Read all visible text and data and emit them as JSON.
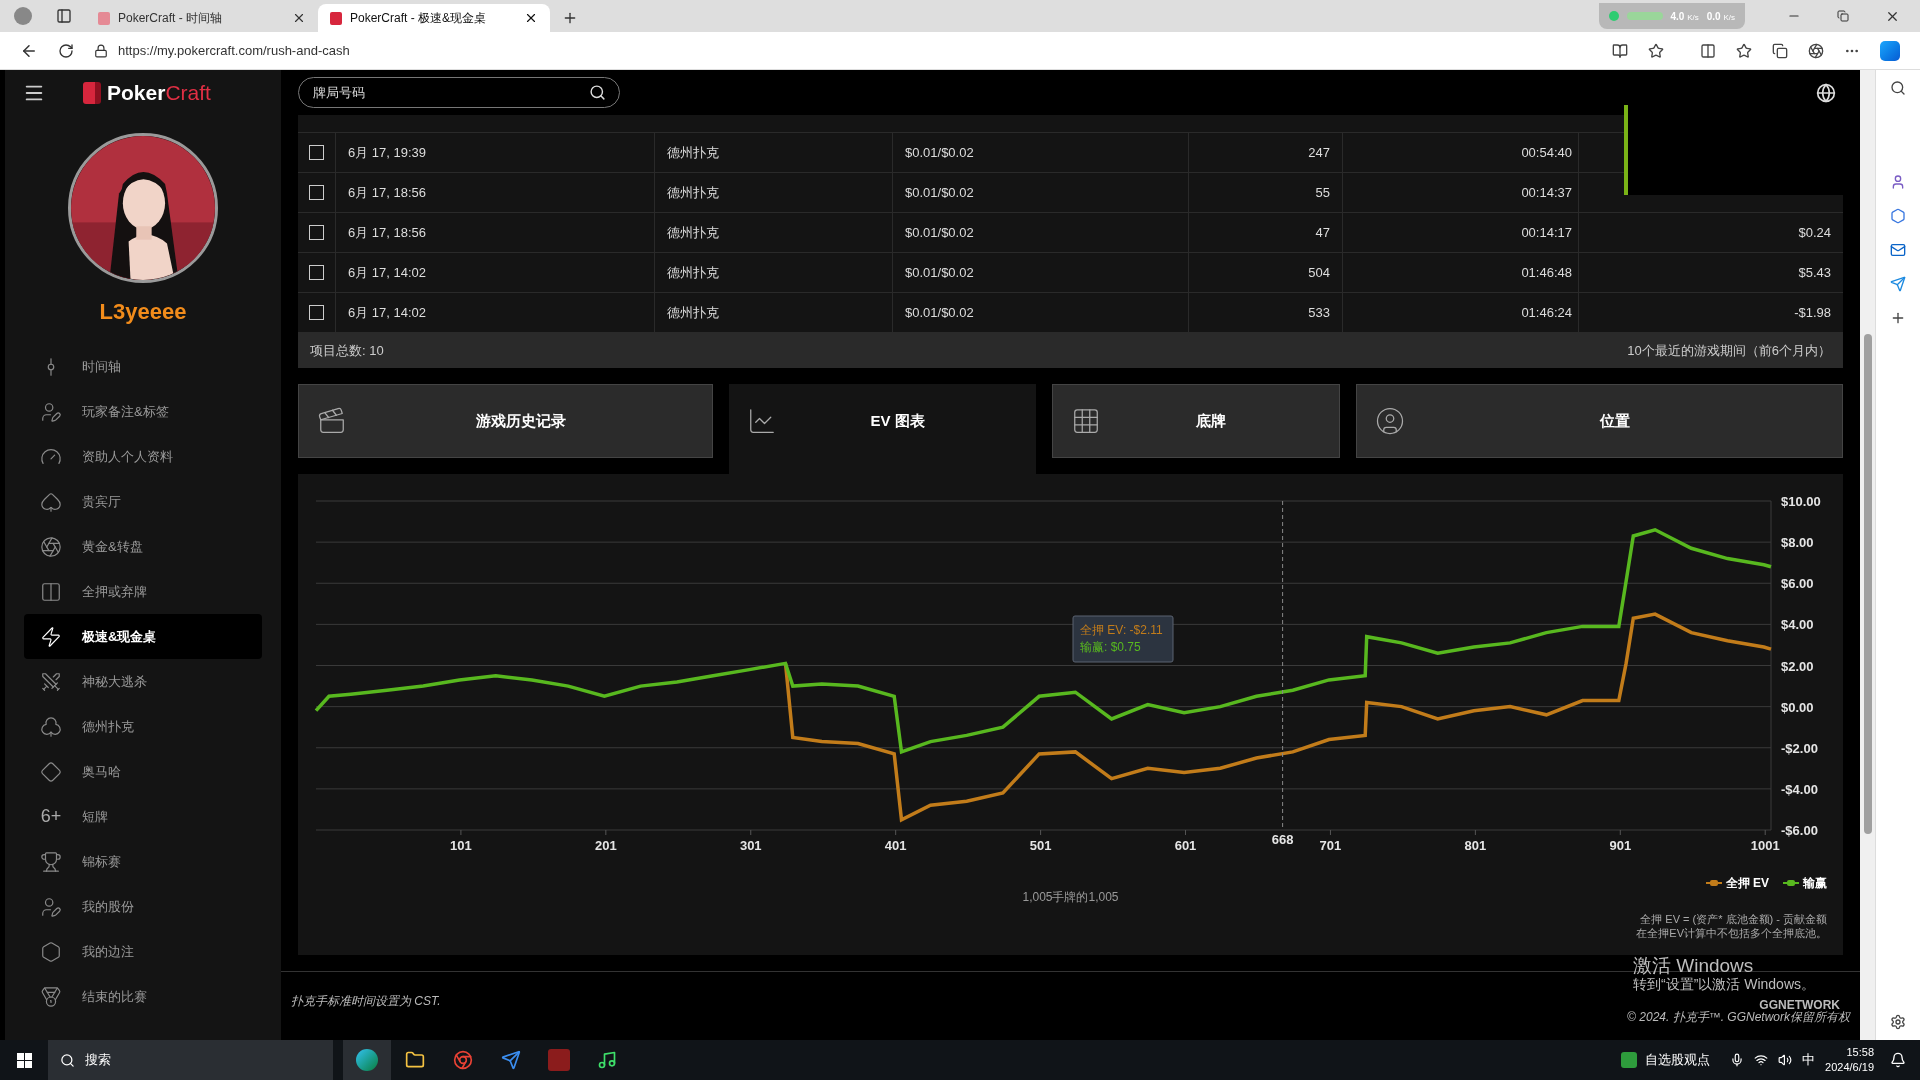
{
  "browser": {
    "tabs": [
      {
        "title": "PokerCraft - 时间轴",
        "selected": false
      },
      {
        "title": "PokerCraft - 极速&现金桌",
        "selected": true
      }
    ],
    "url": "https://my.pokercraft.com/rush-and-cash",
    "network_speeds": [
      {
        "value": "4.0",
        "unit": "K/s"
      },
      {
        "value": "0.0",
        "unit": "K/s"
      }
    ]
  },
  "logo": {
    "first": "Poker",
    "second": "Craft"
  },
  "search": {
    "placeholder": "牌局号码"
  },
  "user": {
    "name": "L3yeeee"
  },
  "nav": [
    {
      "label": "时间轴",
      "selected": false
    },
    {
      "label": "玩家备注&标签",
      "selected": false
    },
    {
      "label": "资助人个人资料",
      "selected": false
    },
    {
      "label": "贵宾厅",
      "selected": false
    },
    {
      "label": "黄金&转盘",
      "selected": false
    },
    {
      "label": "全押或弃牌",
      "selected": false
    },
    {
      "label": "极速&现金桌",
      "selected": true
    },
    {
      "label": "神秘大逃杀",
      "selected": false
    },
    {
      "label": "德州扑克",
      "selected": false
    },
    {
      "label": "奥马哈",
      "selected": false
    },
    {
      "label": "短牌",
      "selected": false,
      "glyph": "6+"
    },
    {
      "label": "锦标赛",
      "selected": false
    },
    {
      "label": "我的股份",
      "selected": false
    },
    {
      "label": "我的边注",
      "selected": false
    },
    {
      "label": "结束的比赛",
      "selected": false
    }
  ],
  "table": {
    "rows": [
      {
        "checked": false,
        "date": "6月 17, 19:39",
        "game": "德州扑克",
        "stakes": "$0.01/$0.02",
        "hands": "247",
        "duration": "00:54:40"
      },
      {
        "checked": false,
        "date": "6月 17, 18:56",
        "game": "德州扑克",
        "stakes": "$0.01/$0.02",
        "hands": "55",
        "duration": "00:14:37"
      },
      {
        "checked": false,
        "date": "6月 17, 18:56",
        "game": "德州扑克",
        "stakes": "$0.01/$0.02",
        "hands": "47",
        "duration": "00:14:17",
        "result": "$0.24"
      },
      {
        "checked": false,
        "date": "6月 17, 14:02",
        "game": "德州扑克",
        "stakes": "$0.01/$0.02",
        "hands": "504",
        "duration": "01:46:48",
        "result": "$5.43"
      },
      {
        "checked": false,
        "date": "6月 17, 14:02",
        "game": "德州扑克",
        "stakes": "$0.01/$0.02",
        "hands": "533",
        "duration": "01:46:24",
        "result": "-$1.98"
      }
    ],
    "total": "项目总数: 10",
    "summary": "10个最近的游戏期间（前6个月内）"
  },
  "view_tabs": [
    {
      "label": "游戏历史记录",
      "selected": false
    },
    {
      "label": "EV 图表",
      "selected": true
    },
    {
      "label": "底牌",
      "selected": false
    },
    {
      "label": "位置",
      "selected": false
    }
  ],
  "ev_chart": {
    "chart_data": {
      "type": "line",
      "x": [
        1,
        10,
        25,
        50,
        75,
        100,
        125,
        150,
        175,
        200,
        225,
        250,
        275,
        300,
        325,
        330,
        350,
        375,
        400,
        405,
        425,
        450,
        475,
        500,
        525,
        550,
        575,
        600,
        625,
        650,
        675,
        700,
        725,
        726,
        750,
        775,
        800,
        825,
        850,
        875,
        900,
        905,
        910,
        925,
        950,
        975,
        1000,
        1005
      ],
      "series": [
        {
          "name": "全押 EV",
          "color": "#c27c1a",
          "values": [
            null,
            null,
            null,
            null,
            null,
            null,
            null,
            null,
            null,
            null,
            null,
            null,
            null,
            null,
            2.1,
            -1.5,
            -1.7,
            -1.8,
            -2.3,
            -5.5,
            -4.8,
            -4.6,
            -4.2,
            -2.3,
            -2.2,
            -3.5,
            -3.0,
            -3.2,
            -3.0,
            -2.5,
            -2.2,
            -1.6,
            -1.4,
            0.2,
            0.0,
            -0.6,
            -0.2,
            0.0,
            -0.4,
            0.3,
            0.3,
            2.1,
            4.3,
            4.5,
            3.6,
            3.2,
            2.9,
            2.8
          ]
        },
        {
          "name": "输赢",
          "color": "#58b81f",
          "values": [
            -0.2,
            0.5,
            0.6,
            0.8,
            1.0,
            1.3,
            1.5,
            1.3,
            1.0,
            0.5,
            1.0,
            1.2,
            1.5,
            1.8,
            2.1,
            1.0,
            1.1,
            1.0,
            0.5,
            -2.2,
            -1.7,
            -1.4,
            -1.0,
            0.5,
            0.7,
            -0.6,
            0.1,
            -0.3,
            0.0,
            0.5,
            0.8,
            1.3,
            1.5,
            3.4,
            3.1,
            2.6,
            2.9,
            3.1,
            3.6,
            3.9,
            3.9,
            6.1,
            8.3,
            8.6,
            7.7,
            7.2,
            6.9,
            6.8
          ]
        }
      ],
      "xlim": [
        1,
        1005
      ],
      "ylim": [
        -6,
        10
      ],
      "xticks": [
        101,
        201,
        301,
        401,
        501,
        601,
        701,
        801,
        901,
        1001
      ],
      "yticks": [
        {
          "value": 10,
          "label": "$10.00"
        },
        {
          "value": 8,
          "label": "$8.00"
        },
        {
          "value": 6,
          "label": "$6.00"
        },
        {
          "value": 4,
          "label": "$4.00"
        },
        {
          "value": 2,
          "label": "$2.00"
        },
        {
          "value": 0,
          "label": "$0.00"
        },
        {
          "value": -2,
          "label": "-$2.00"
        },
        {
          "value": -4,
          "label": "-$4.00"
        },
        {
          "value": -6,
          "label": "-$6.00"
        }
      ],
      "grid": true,
      "ref_lines": [
        {
          "axis": "x",
          "value": 668,
          "label": "668"
        }
      ]
    },
    "tooltip": [
      "全押 EV: -$2.11",
      "输赢: $0.75"
    ],
    "caption": "1,005手牌的1,005",
    "note": [
      "全押 EV = (资产* 底池金额) - 贡献金额",
      "在全押EV计算中不包括多个全押底池。"
    ]
  },
  "footer": {
    "timezone": "扑克手标准时间设置为 CST.",
    "copyright": "© 2024. 扑克手™. GGNetwork保留所有权",
    "brand": "GGNETWORK"
  },
  "windows_activation": {
    "title": "激活 Windows",
    "hint": "转到“设置”以激活 Windows。"
  },
  "taskbar": {
    "search": "搜索",
    "widget": "自选股观点",
    "ime": "中",
    "time": "15:58",
    "date": "2024/6/19"
  }
}
